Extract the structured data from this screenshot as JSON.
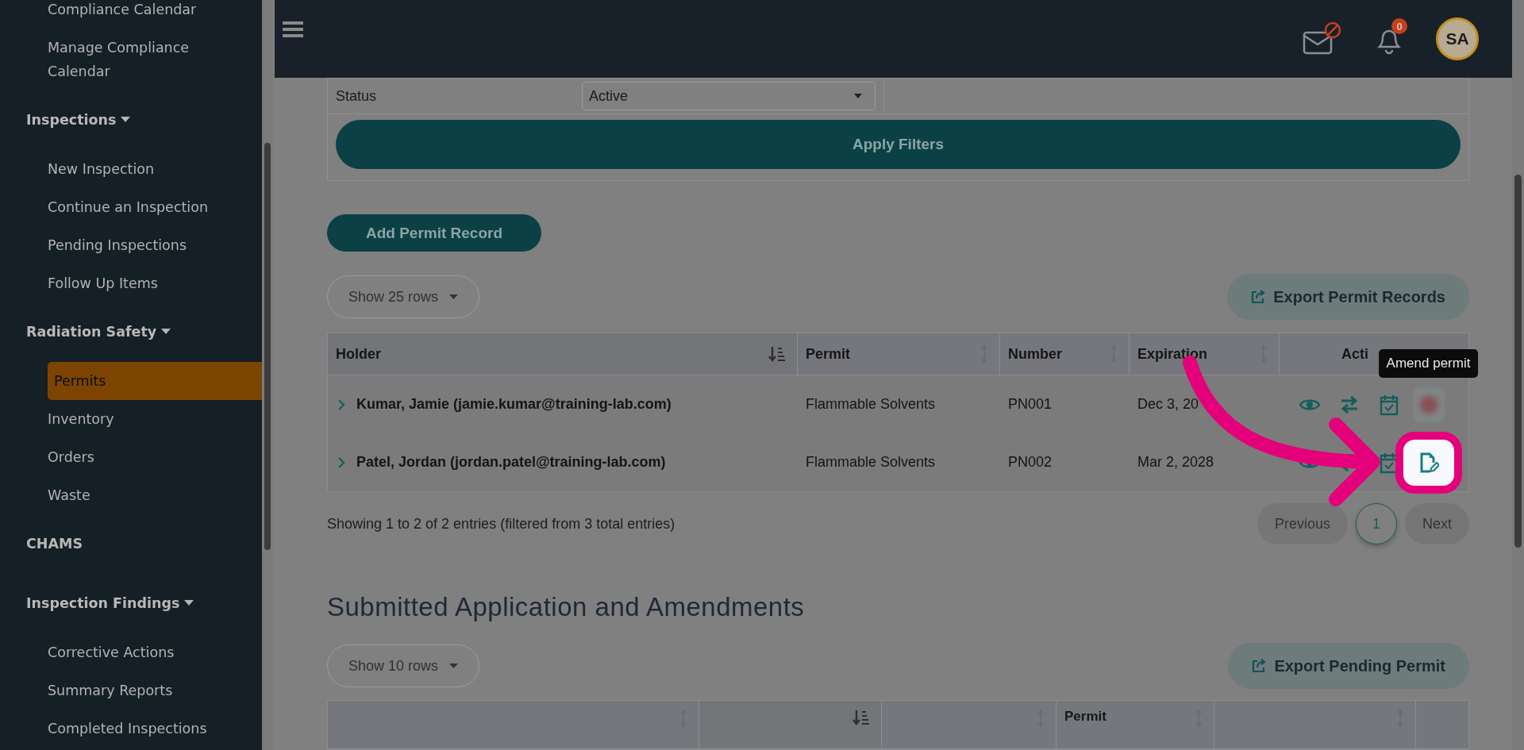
{
  "sidebar": {
    "items": [
      {
        "kind": "link",
        "label": "Compliance Calendar",
        "selected": false
      },
      {
        "kind": "link",
        "label": "Manage Compliance Calendar",
        "selected": false
      },
      {
        "kind": "section",
        "label": "Inspections",
        "expanded": true
      },
      {
        "kind": "link",
        "label": "New Inspection",
        "selected": false
      },
      {
        "kind": "link",
        "label": "Continue an Inspection",
        "selected": false
      },
      {
        "kind": "link",
        "label": "Pending Inspections",
        "selected": false
      },
      {
        "kind": "link",
        "label": "Follow Up Items",
        "selected": false
      },
      {
        "kind": "section",
        "label": "Radiation Safety",
        "expanded": true
      },
      {
        "kind": "link",
        "label": "Permits",
        "selected": true
      },
      {
        "kind": "link",
        "label": "Inventory",
        "selected": false
      },
      {
        "kind": "link",
        "label": "Orders",
        "selected": false
      },
      {
        "kind": "link",
        "label": "Waste",
        "selected": false
      },
      {
        "kind": "heading",
        "label": "CHAMS"
      },
      {
        "kind": "section",
        "label": "Inspection Findings",
        "expanded": true
      },
      {
        "kind": "link",
        "label": "Corrective Actions",
        "selected": false
      },
      {
        "kind": "link",
        "label": "Summary Reports",
        "selected": false
      },
      {
        "kind": "link",
        "label": "Completed Inspections",
        "selected": false
      }
    ]
  },
  "topbar": {
    "notification_count": "0",
    "avatar": "SA"
  },
  "filters": {
    "status_label": "Status",
    "status_value": "Active",
    "apply_button": "Apply Filters"
  },
  "add_button": "Add Permit Record",
  "permits": {
    "rows_select": "Show 25 rows",
    "export_button": "Export Permit Records",
    "columns": [
      {
        "label": "Holder",
        "kind": "sortable",
        "sorted": true
      },
      {
        "label": "Permit",
        "kind": "sortable",
        "sorted": false
      },
      {
        "label": "Number",
        "kind": "sortable",
        "sorted": false
      },
      {
        "label": "Expiration",
        "kind": "sortable",
        "sorted": false
      },
      {
        "label": "Acti",
        "kind": "plain"
      }
    ],
    "rows": [
      {
        "holder": "Kumar, Jamie (jamie.kumar@training-lab.com)",
        "permit": "Flammable Solvents",
        "number": "PN001",
        "expiration": "Dec 3, 20",
        "expanded": false,
        "last_action_blurred": true,
        "last_action_highlighted": false,
        "tooltip": "Amend permit",
        "actions": [
          {
            "kind": "view"
          },
          {
            "kind": "transfer"
          },
          {
            "kind": "schedule"
          },
          {
            "kind": "amend"
          }
        ]
      },
      {
        "holder": "Patel, Jordan (jordan.patel@training-lab.com)",
        "permit": "Flammable Solvents",
        "number": "PN002",
        "expiration": "Mar 2, 2028",
        "expanded": false,
        "last_action_blurred": false,
        "last_action_highlighted": true,
        "actions": [
          {
            "kind": "view"
          },
          {
            "kind": "transfer"
          },
          {
            "kind": "schedule"
          },
          {
            "kind": "amend"
          }
        ]
      }
    ],
    "info": "Showing 1 to 2 of 2 entries (filtered from 3 total entries)",
    "pagination": [
      {
        "label": "Previous",
        "selected": false,
        "disabled": true
      },
      {
        "label": "1",
        "selected": true,
        "disabled": false
      },
      {
        "label": "Next",
        "selected": false,
        "disabled": true
      }
    ]
  },
  "submitted": {
    "heading": "Submitted Application and Amendments",
    "rows_select": "Show 10 rows",
    "export_button": "Export Pending Permit",
    "columns": [
      {
        "kind": "sortable",
        "sorted": false
      },
      {
        "kind": "sortable",
        "sorted": true
      },
      {
        "kind": "sortable",
        "sorted": false
      },
      {
        "label": "Permit",
        "kind": "sortable",
        "sorted": false
      },
      {
        "kind": "sortable",
        "sorted": false
      },
      {
        "kind": "plain"
      }
    ]
  }
}
